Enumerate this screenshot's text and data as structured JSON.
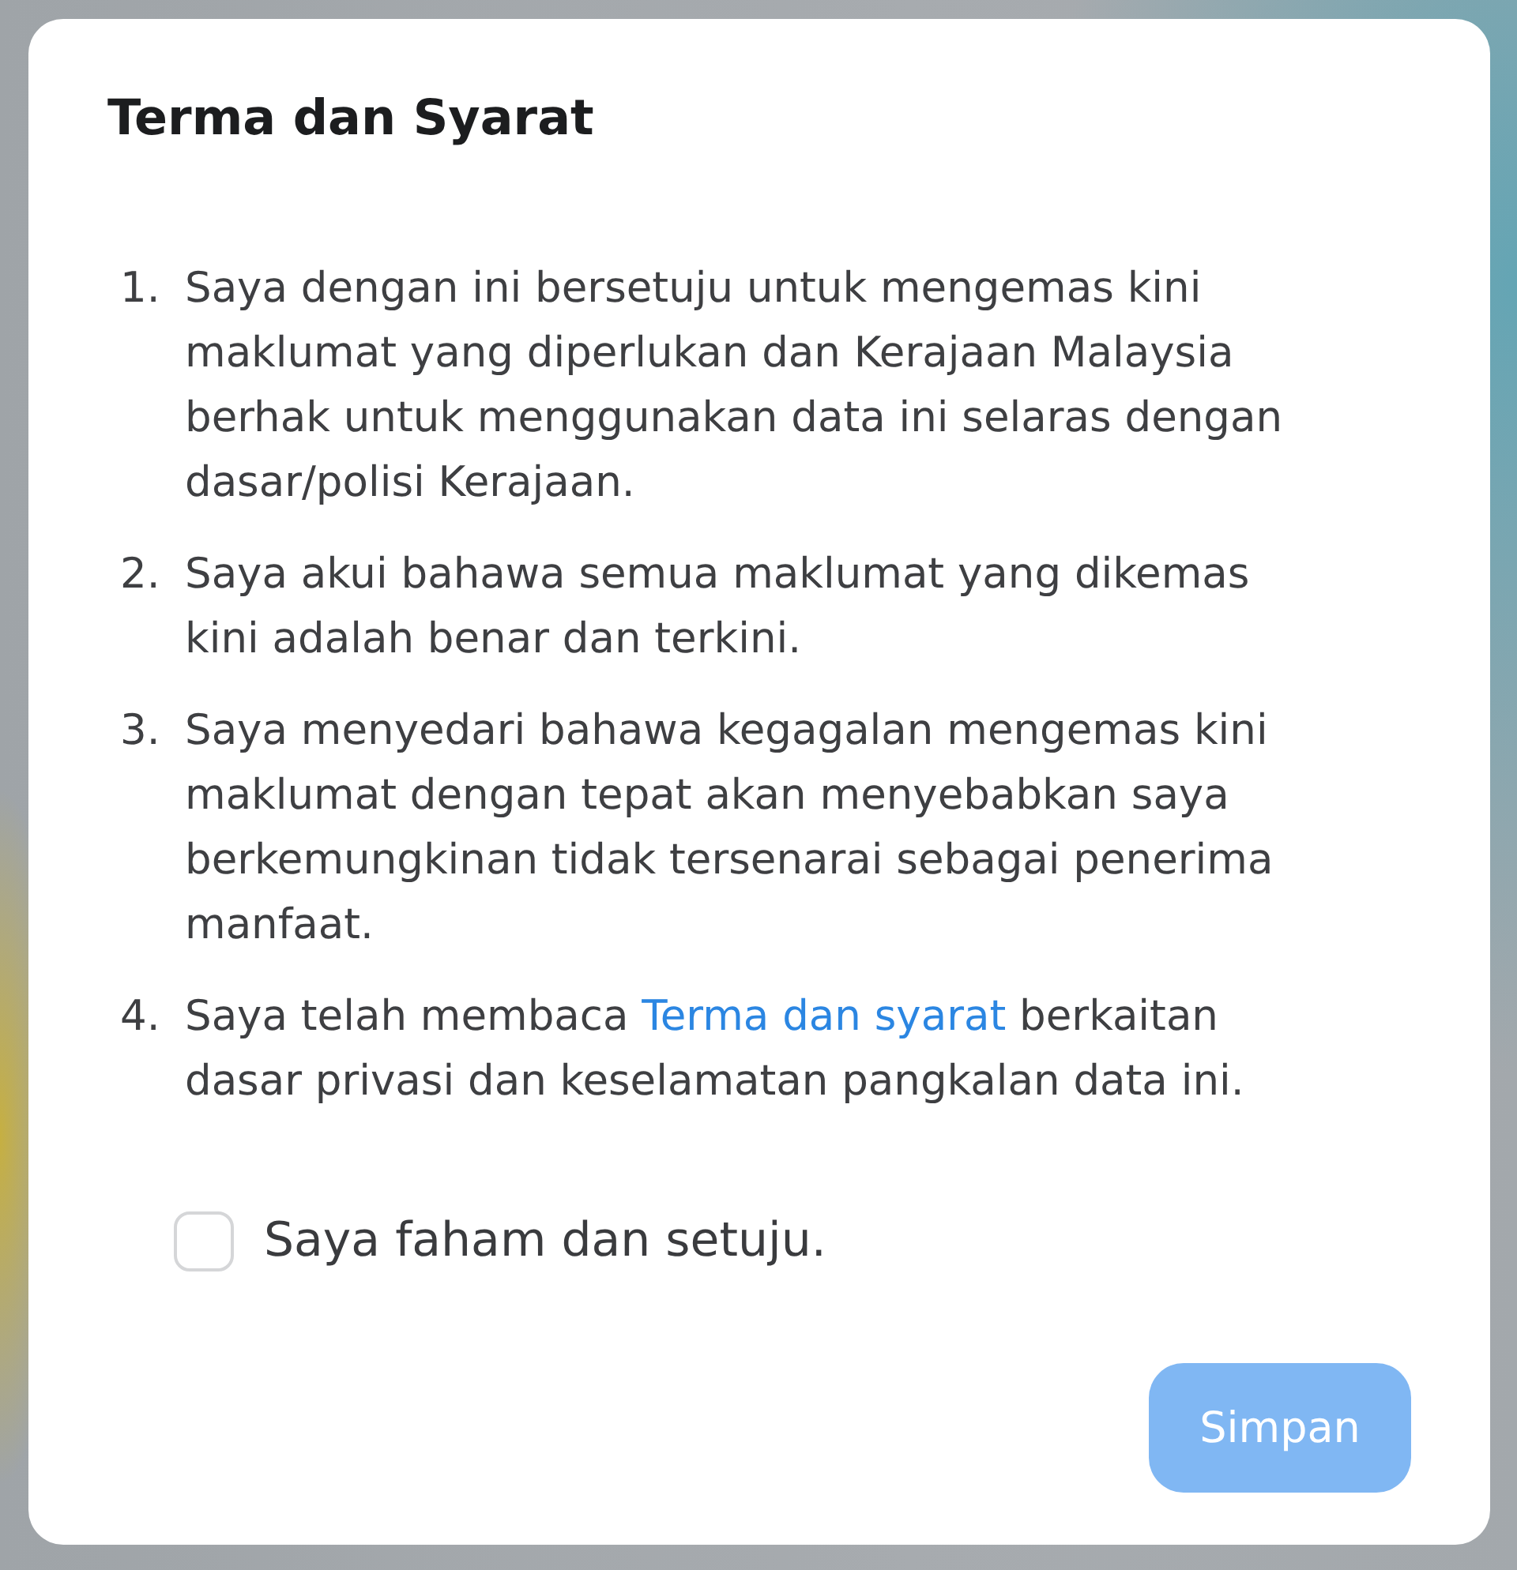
{
  "dialog": {
    "title": "Terma dan Syarat"
  },
  "terms": [
    {
      "number": "1.",
      "text": "Saya dengan ini bersetuju untuk mengemas kini maklumat yang diperlukan dan Kerajaan Malaysia berhak untuk menggunakan data ini selaras dengan dasar/polisi Kerajaan."
    },
    {
      "number": "2.",
      "text": "Saya akui bahawa semua maklumat yang dikemas kini adalah benar dan terkini."
    },
    {
      "number": "3.",
      "text": "Saya menyedari bahawa kegagalan mengemas kini maklumat dengan tepat akan menyebabkan saya berkemungkinan tidak tersenarai sebagai penerima manfaat."
    },
    {
      "number": "4.",
      "text": "Saya telah membaca",
      "link": "Terma dan syarat",
      "text_after": "berkaitan dasar privasi dan keselamatan pangkalan data ini."
    }
  ],
  "agreement": {
    "label": "Saya faham dan setuju.",
    "checked": false
  },
  "save_button": {
    "label": "Simpan",
    "disabled": true
  }
}
